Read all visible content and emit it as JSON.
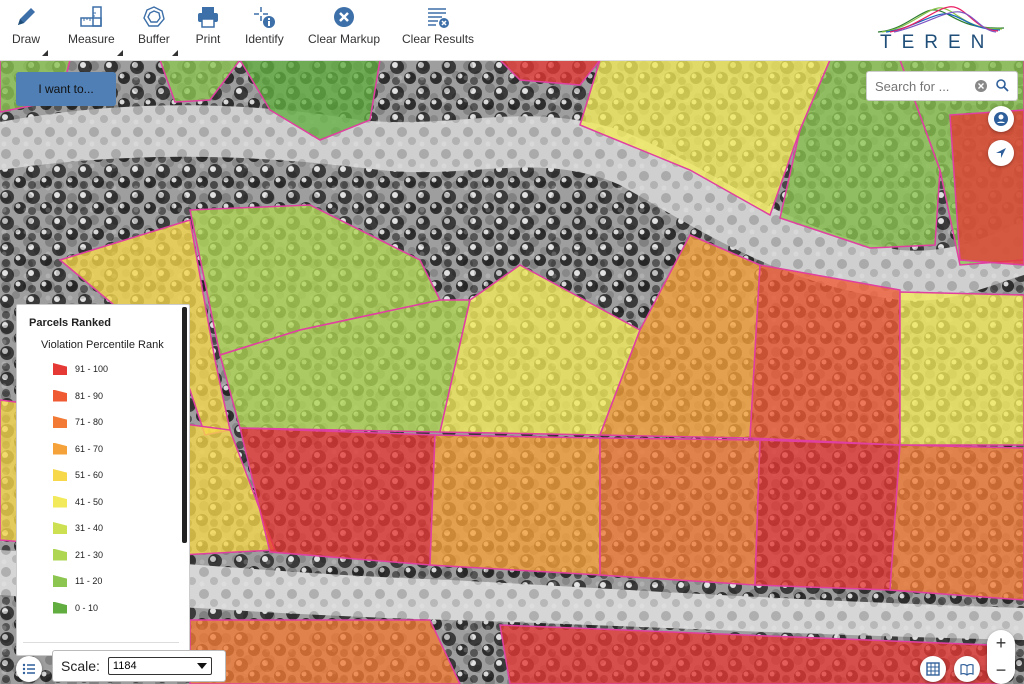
{
  "toolbar": {
    "items": [
      {
        "label": "Draw",
        "icon": "pencil-icon",
        "has_menu": true
      },
      {
        "label": "Measure",
        "icon": "ruler-icon",
        "has_menu": true
      },
      {
        "label": "Buffer",
        "icon": "buffer-icon",
        "has_menu": true
      },
      {
        "label": "Print",
        "icon": "printer-icon",
        "has_menu": false
      },
      {
        "label": "Identify",
        "icon": "identify-icon",
        "has_menu": false
      },
      {
        "label": "Clear Markup",
        "icon": "clear-markup-icon",
        "has_menu": false
      },
      {
        "label": "Clear Results",
        "icon": "clear-results-icon",
        "has_menu": false
      }
    ]
  },
  "logo": {
    "text": "TEREN",
    "colors": [
      "#2e7d32",
      "#8bc34a",
      "#1565c0",
      "#e91e63",
      "#7e57c2"
    ]
  },
  "i_want": {
    "label": "I want to..."
  },
  "search": {
    "placeholder": "Search for ..."
  },
  "legend": {
    "title": "Parcels Ranked",
    "subtitle": "Violation Percentile Rank",
    "items": [
      {
        "label": "91 - 100",
        "color": "#e53935"
      },
      {
        "label": "81 - 90",
        "color": "#ef5a33"
      },
      {
        "label": "71 - 80",
        "color": "#f27a35"
      },
      {
        "label": "61 - 70",
        "color": "#f6a23a"
      },
      {
        "label": "51 - 60",
        "color": "#f6d84a"
      },
      {
        "label": "41 - 50",
        "color": "#f2ea5a"
      },
      {
        "label": "31 - 40",
        "color": "#cde052"
      },
      {
        "label": "21 - 30",
        "color": "#aed653"
      },
      {
        "label": "11 - 20",
        "color": "#8cc54f"
      },
      {
        "label": "0 - 10",
        "color": "#62ad3f"
      }
    ]
  },
  "scale": {
    "label": "Scale:",
    "value": "1184"
  },
  "zoom": {
    "in": "+",
    "out": "−"
  },
  "colors": {
    "parcel_border": "#e040a0",
    "accent": "#4f7fb5"
  }
}
